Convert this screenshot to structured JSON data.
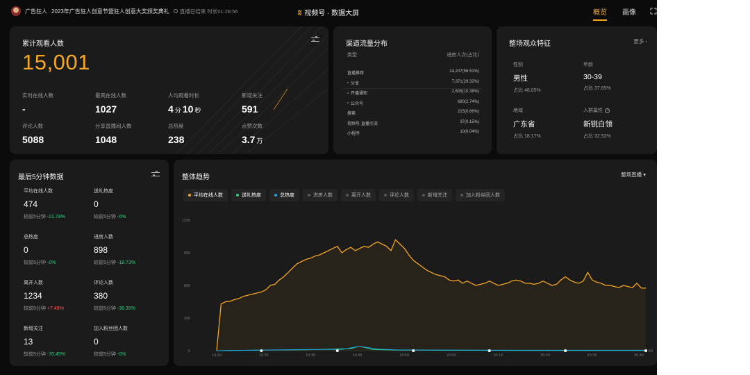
{
  "header": {
    "account_name": "广告狂人",
    "live_title": "2023年广告狂人创意节暨狂人创意大奖颁奖典礼",
    "live_status": "直播已结束 时长01:28:56",
    "app_title": "视频号 · 数据大屏",
    "tabs": [
      {
        "label": "概览",
        "active": true
      },
      {
        "label": "画像",
        "active": false
      }
    ]
  },
  "overview": {
    "title": "累计观看人数",
    "total_viewers": "15,001",
    "stats": [
      {
        "label": "实时在线人数",
        "value": "-"
      },
      {
        "label": "最高在线人数",
        "value": "1027"
      },
      {
        "label": "人均观看时长",
        "value_min": "4",
        "unit_min": "分",
        "value_sec": "10",
        "unit_sec": "秒"
      },
      {
        "label": "新增关注",
        "value": "591"
      },
      {
        "label": "评论人数",
        "value": "5088"
      },
      {
        "label": "分享直播间人数",
        "value": "1048"
      },
      {
        "label": "总热度",
        "value": "238"
      },
      {
        "label": "点赞次数",
        "value": "3.7",
        "unit": "万"
      }
    ]
  },
  "channels": {
    "title": "渠道流量分布",
    "col_type": "类型",
    "col_value": "进房人次(占比)",
    "rows": [
      {
        "name": "直播推荐",
        "value": "14,207(56.51%)",
        "bullet": false
      },
      {
        "name": "分享",
        "value": "7,371(29.32%)",
        "bullet": true
      },
      {
        "name": "开播通知",
        "value": "2,609(10.38%)",
        "bullet": true
      },
      {
        "name": "公众号",
        "value": "690(2.74%)",
        "bullet": true
      },
      {
        "name": "搜索",
        "value": "215(0.86%)",
        "bullet": false
      },
      {
        "name": "视频号·直播引流",
        "value": "37(0.15%)",
        "bullet": false
      },
      {
        "name": "小程序",
        "value": "10(0.04%)",
        "bullet": false
      }
    ]
  },
  "audience": {
    "title": "整场观众特征",
    "more": "更多 ›",
    "items": [
      {
        "label": "性别",
        "value": "男性",
        "pct": "占比 46.05%",
        "info": false
      },
      {
        "label": "年龄",
        "value": "30-39",
        "pct": "占比 37.65%",
        "info": false
      },
      {
        "label": "地域",
        "value": "广东省",
        "pct": "占比 18.17%",
        "info": false
      },
      {
        "label": "人群属性",
        "value": "新锐白领",
        "pct": "占比 32.52%",
        "info": true
      }
    ]
  },
  "last5": {
    "title": "最后5分钟数据",
    "cmp_prefix": "较前5分钟",
    "items": [
      {
        "label": "平均在线人数",
        "value": "474",
        "delta": "-21.78%",
        "dir": "down"
      },
      {
        "label": "送礼热度",
        "value": "0",
        "delta": "-0%",
        "dir": "down"
      },
      {
        "label": "总热度",
        "value": "0",
        "delta": "-0%",
        "dir": "down"
      },
      {
        "label": "进房人数",
        "value": "898",
        "delta": "-18.73%",
        "dir": "down"
      },
      {
        "label": "离开人数",
        "value": "1234",
        "delta": "+7.49%",
        "dir": "up"
      },
      {
        "label": "评论人数",
        "value": "380",
        "delta": "-36.35%",
        "dir": "down"
      },
      {
        "label": "新增关注",
        "value": "13",
        "delta": "-70.45%",
        "dir": "down"
      },
      {
        "label": "加入粉丝团人数",
        "value": "0",
        "delta": "-0%",
        "dir": "down"
      }
    ]
  },
  "trend": {
    "title": "整体趋势",
    "dropdown": "整场直播 ▾",
    "chips": [
      {
        "label": "平均在线人数",
        "color": "#f5a623",
        "on": true
      },
      {
        "label": "送礼热度",
        "color": "#2bd07a",
        "on": true
      },
      {
        "label": "总热度",
        "color": "#1aa3e8",
        "on": true
      },
      {
        "label": "进房人数",
        "color": "#555555",
        "on": false
      },
      {
        "label": "离开人数",
        "color": "#555555",
        "on": false
      },
      {
        "label": "评论人数",
        "color": "#555555",
        "on": false
      },
      {
        "label": "新增关注",
        "color": "#555555",
        "on": false
      },
      {
        "label": "加入粉丝团人数",
        "color": "#555555",
        "on": false
      }
    ]
  },
  "colors": {
    "accent": "#f5a623",
    "up": "#ff5a5a",
    "down": "#2bd07a",
    "blue": "#1aa3e8"
  },
  "chart_data": {
    "type": "line",
    "x": [
      "19:19",
      "19:29",
      "19:39",
      "19:49",
      "19:59",
      "20:09",
      "20:19",
      "20:29",
      "20:39",
      "20:49"
    ],
    "yticks": [
      "0",
      "300",
      "600",
      "900",
      "1200"
    ],
    "ylim": [
      0,
      1200
    ],
    "right_axis_label": "60",
    "series": [
      {
        "name": "平均在线人数",
        "color": "#f5a623",
        "points": [
          [
            0,
            0
          ],
          [
            1,
            430
          ],
          [
            2,
            450
          ],
          [
            3,
            455
          ],
          [
            4,
            470
          ],
          [
            5,
            480
          ],
          [
            6,
            500
          ],
          [
            7,
            510
          ],
          [
            8,
            520
          ],
          [
            10,
            540
          ],
          [
            11,
            560
          ],
          [
            12,
            600
          ],
          [
            13,
            610
          ],
          [
            14,
            650
          ],
          [
            15,
            680
          ],
          [
            16,
            720
          ],
          [
            17,
            760
          ],
          [
            18,
            800
          ],
          [
            19,
            820
          ],
          [
            20,
            840
          ],
          [
            21,
            850
          ],
          [
            22,
            870
          ],
          [
            23,
            880
          ],
          [
            24,
            900
          ],
          [
            25,
            920
          ],
          [
            26,
            940
          ],
          [
            27,
            960
          ],
          [
            28,
            900
          ],
          [
            29,
            930
          ],
          [
            30,
            950
          ],
          [
            31,
            920
          ],
          [
            32,
            940
          ],
          [
            33,
            960
          ],
          [
            34,
            950
          ],
          [
            35,
            980
          ],
          [
            36,
            1000
          ],
          [
            37,
            980
          ],
          [
            38,
            960
          ],
          [
            39,
            920
          ],
          [
            40,
            1020
          ],
          [
            41,
            980
          ],
          [
            42,
            940
          ],
          [
            43,
            880
          ],
          [
            44,
            830
          ],
          [
            45,
            800
          ],
          [
            46,
            770
          ],
          [
            47,
            740
          ],
          [
            48,
            720
          ],
          [
            49,
            700
          ],
          [
            50,
            690
          ],
          [
            51,
            680
          ],
          [
            52,
            650
          ],
          [
            53,
            640
          ],
          [
            54,
            650
          ],
          [
            55,
            620
          ],
          [
            56,
            640
          ],
          [
            57,
            620
          ],
          [
            58,
            600
          ],
          [
            59,
            610
          ],
          [
            60,
            620
          ],
          [
            61,
            640
          ],
          [
            62,
            620
          ],
          [
            63,
            600
          ],
          [
            64,
            610
          ],
          [
            65,
            620
          ],
          [
            66,
            640
          ],
          [
            67,
            650
          ],
          [
            68,
            640
          ],
          [
            69,
            620
          ],
          [
            70,
            620
          ],
          [
            71,
            610
          ],
          [
            72,
            620
          ],
          [
            73,
            640
          ],
          [
            74,
            620
          ],
          [
            75,
            600
          ],
          [
            76,
            610
          ],
          [
            77,
            650
          ],
          [
            78,
            680
          ],
          [
            79,
            650
          ],
          [
            80,
            630
          ],
          [
            81,
            620
          ],
          [
            82,
            640
          ],
          [
            83,
            720
          ],
          [
            84,
            650
          ],
          [
            85,
            630
          ],
          [
            86,
            620
          ],
          [
            87,
            600
          ],
          [
            88,
            600
          ],
          [
            89,
            590
          ],
          [
            90,
            580
          ],
          [
            91,
            600
          ],
          [
            92,
            590
          ],
          [
            93,
            580
          ],
          [
            94,
            620
          ],
          [
            95,
            575
          ],
          [
            96,
            575
          ]
        ]
      },
      {
        "name": "送礼热度",
        "color": "#2bd07a",
        "points": [
          [
            0,
            0
          ],
          [
            10,
            5
          ],
          [
            20,
            8
          ],
          [
            30,
            20
          ],
          [
            32,
            40
          ],
          [
            35,
            10
          ],
          [
            40,
            6
          ],
          [
            50,
            4
          ],
          [
            60,
            3
          ],
          [
            70,
            2
          ],
          [
            80,
            2
          ],
          [
            90,
            2
          ],
          [
            96,
            2
          ]
        ]
      },
      {
        "name": "总热度",
        "color": "#1aa3e8",
        "points": [
          [
            0,
            0
          ],
          [
            10,
            6
          ],
          [
            20,
            10
          ],
          [
            28,
            12
          ],
          [
            32,
            40
          ],
          [
            36,
            15
          ],
          [
            40,
            8
          ],
          [
            50,
            6
          ],
          [
            60,
            5
          ],
          [
            70,
            4
          ],
          [
            80,
            4
          ],
          [
            90,
            4
          ],
          [
            96,
            4
          ]
        ]
      }
    ],
    "x_max": 96,
    "markers_x": [
      10,
      27,
      44,
      61,
      78,
      96
    ]
  }
}
